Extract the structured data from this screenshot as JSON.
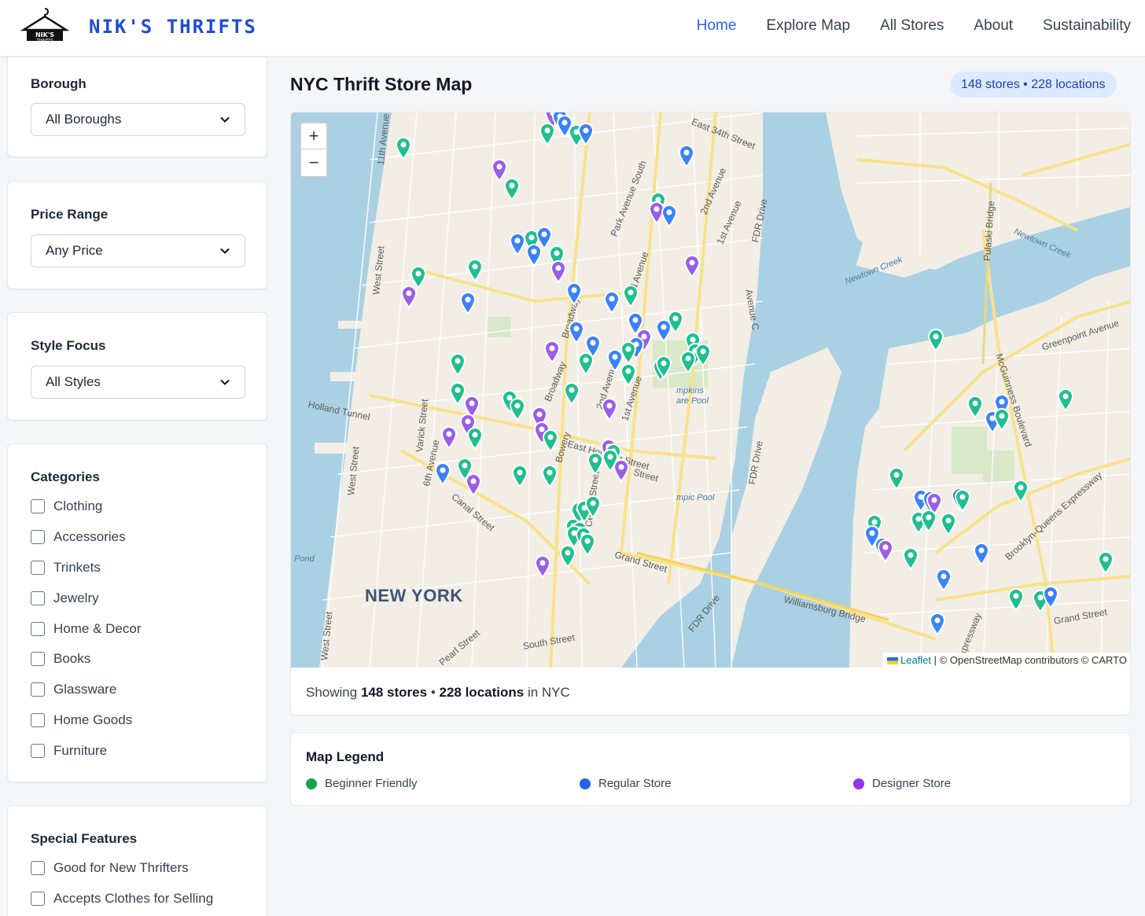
{
  "header": {
    "brand": "NIK'S THRIFTS",
    "logo_text": "NIK'S THRIFTS",
    "nav": [
      {
        "label": "Home",
        "active": true
      },
      {
        "label": "Explore Map",
        "active": false
      },
      {
        "label": "All Stores",
        "active": false
      },
      {
        "label": "About",
        "active": false
      },
      {
        "label": "Sustainability",
        "active": false
      }
    ]
  },
  "filters": {
    "borough": {
      "label": "Borough",
      "value": "All Boroughs"
    },
    "price": {
      "label": "Price Range",
      "value": "Any Price"
    },
    "style": {
      "label": "Style Focus",
      "value": "All Styles"
    },
    "categories": {
      "label": "Categories",
      "items": [
        "Clothing",
        "Accessories",
        "Trinkets",
        "Jewelry",
        "Home & Decor",
        "Books",
        "Glassware",
        "Home Goods",
        "Furniture"
      ]
    },
    "features": {
      "label": "Special Features",
      "items": [
        "Good for New Thrifters",
        "Accepts Clothes for Selling"
      ]
    }
  },
  "main": {
    "title": "NYC Thrift Store Map",
    "badge": "148 stores • 228 locations",
    "showing": {
      "prefix": "Showing",
      "stores": "148 stores",
      "sep": "•",
      "locations": "228 locations",
      "suffix": "in NYC"
    }
  },
  "map": {
    "zoom_in": "+",
    "zoom_out": "−",
    "attribution": {
      "leaflet": "Leaflet",
      "rest": "| © OpenStreetMap contributors © CARTO"
    },
    "city_label": "NEW YORK",
    "streets": [
      "11th Avenue",
      "West Street",
      "Holland Tunnel",
      "Varick Street",
      "6th Avenue",
      "Canal Street",
      "Broadway",
      "Bowery",
      "East Houston Street",
      "2nd Avenue",
      "1st Avenue",
      "3rd Avenue",
      "Park Avenue South",
      "2nd Avenue",
      "1st Avenue",
      "East 34th Street",
      "FDR Drive",
      "Avenue C",
      "FDR Drive",
      "Grand Street",
      "Williamsburg Bridge",
      "FDR Drive",
      "South Street",
      "Pearl Street",
      "Greenpoint Avenue",
      "McGuinness Boulevard",
      "Pulaski Bridge",
      "Brooklyn-Queens Expressway",
      "Grand Street",
      "West Street",
      "West Street",
      "Broadway",
      "Centre Street",
      "Street",
      "Expressway"
    ],
    "water_labels": [
      "Newtown Creek",
      "Newtown Creek",
      "Pond",
      "mpkins are Pool",
      "mpic Pool"
    ],
    "colors": {
      "beginner": "#1fbf8f",
      "regular": "#3b82f6",
      "designer": "#9b5de5"
    }
  },
  "legend": {
    "title": "Map Legend",
    "items": [
      {
        "label": "Beginner Friendly",
        "color": "#16a34a"
      },
      {
        "label": "Regular Store",
        "color": "#2563eb"
      },
      {
        "label": "Designer Store",
        "color": "#9333ea"
      }
    ]
  }
}
